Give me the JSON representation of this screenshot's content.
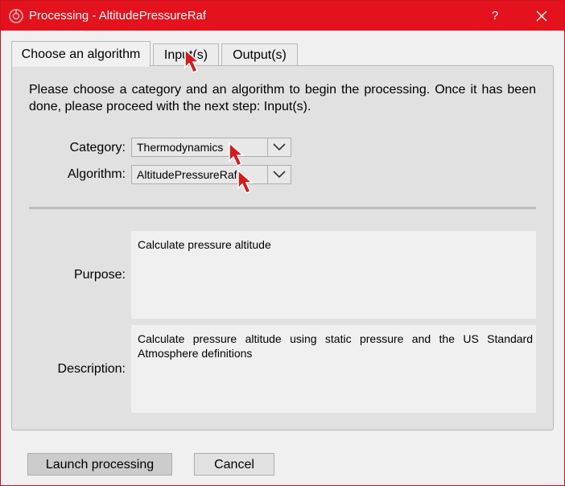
{
  "window": {
    "title": "Processing - AltitudePressureRaf",
    "help_label": "?",
    "accent_color": "#e3121d"
  },
  "tabs": [
    {
      "label": "Choose an algorithm",
      "active": true
    },
    {
      "label": "Input(s)",
      "active": false
    },
    {
      "label": "Output(s)",
      "active": false
    }
  ],
  "content": {
    "instructions": "Please choose a category and an algorithm to begin the processing. Once it has been done, please proceed with the next step: Input(s).",
    "category": {
      "label": "Category:",
      "value": "Thermodynamics"
    },
    "algorithm": {
      "label": "Algorithm:",
      "value": "AltitudePressureRaf"
    },
    "purpose": {
      "label": "Purpose:",
      "text": "Calculate pressure altitude"
    },
    "description": {
      "label": "Description:",
      "text": "Calculate pressure altitude using static pressure and the US Standard Atmosphere definitions"
    }
  },
  "buttons": {
    "launch": "Launch processing",
    "cancel": "Cancel"
  },
  "icons": {
    "app": "app-logo-icon",
    "close": "close-icon",
    "dropdown": "chevron-down-icon",
    "cursor": "mouse-pointer-icon"
  }
}
